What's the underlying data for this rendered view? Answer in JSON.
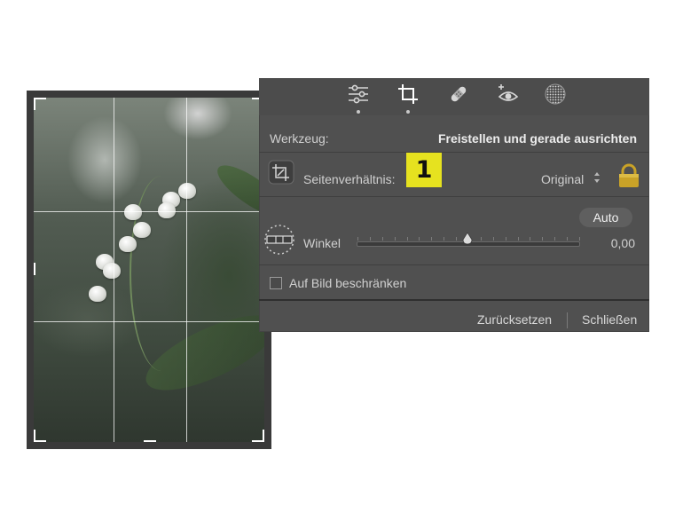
{
  "toolbar": {
    "tools": [
      {
        "icon": "sliders-icon",
        "active": false
      },
      {
        "icon": "crop-icon",
        "active": true
      },
      {
        "icon": "bandage-icon",
        "active": false
      },
      {
        "icon": "red-eye-icon",
        "active": false
      },
      {
        "icon": "mask-circle-icon",
        "active": false
      }
    ]
  },
  "tool_row": {
    "label": "Werkzeug:",
    "value": "Freistellen und gerade ausrichten"
  },
  "aspect_row": {
    "label": "Seitenverhältnis:",
    "value": "Original",
    "badge": "1"
  },
  "angle_row": {
    "auto_label": "Auto",
    "label": "Winkel",
    "value": "0,00",
    "slider_fraction": 0.5
  },
  "constrain": {
    "label": "Auf Bild beschränken",
    "checked": false
  },
  "footer": {
    "reset_label": "Zurücksetzen",
    "close_label": "Schließen"
  },
  "colors": {
    "panel_bg": "#505050",
    "badge_bg": "#e6e21f",
    "lock_gold": "#c9a227"
  }
}
